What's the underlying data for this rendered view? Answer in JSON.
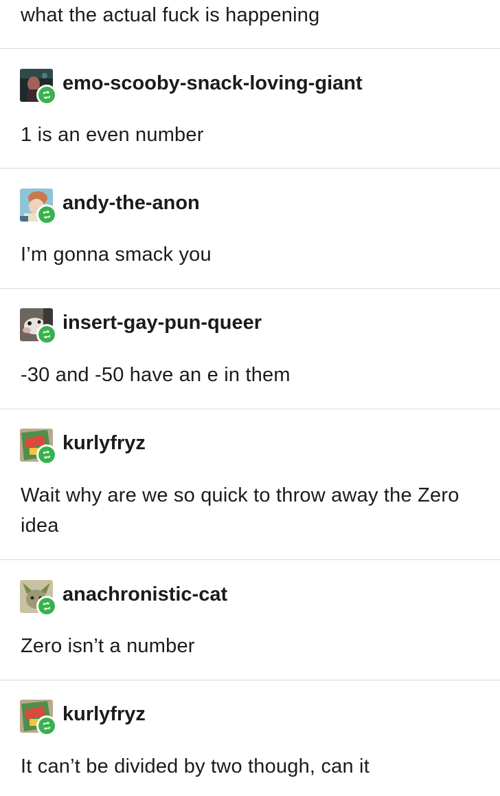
{
  "intro_text": "what the actual fuck is happening",
  "posts": [
    {
      "username": "emo-scooby-snack-loving-giant",
      "text": "1 is an even number",
      "avatar": "dark-portrait-avatar"
    },
    {
      "username": "andy-the-anon",
      "text": "I’m gonna smack you",
      "avatar": "anime-character-avatar"
    },
    {
      "username": "insert-gay-pun-queer",
      "text": "-30 and -50 have an e in them",
      "avatar": "opossum-avatar"
    },
    {
      "username": "kurlyfryz",
      "text": "Wait why are we so quick to throw away the Zero idea",
      "avatar": "snack-bag-avatar"
    },
    {
      "username": "anachronistic-cat",
      "text": "Zero isn’t a number",
      "avatar": "cat-avatar"
    },
    {
      "username": "kurlyfryz",
      "text": "It can’t be divided by two though, can it",
      "avatar": "snack-bag-avatar"
    }
  ],
  "colors": {
    "reblog_green": "#38b24d",
    "divider": "#d9d9d9",
    "text": "#1b1b1b"
  }
}
